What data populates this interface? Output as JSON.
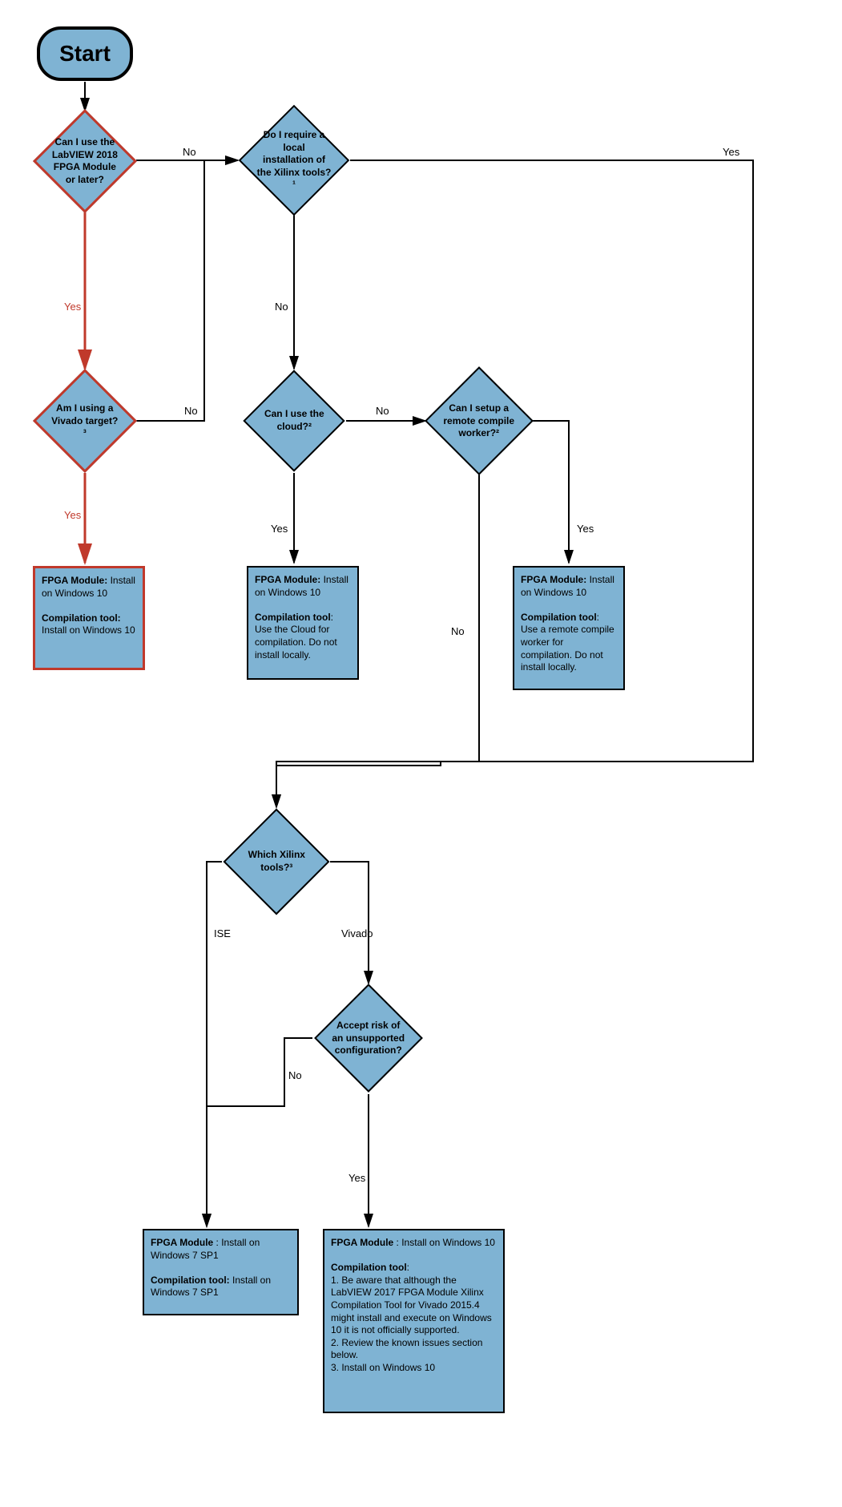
{
  "chart_data": {
    "type": "flowchart",
    "nodes": [
      {
        "id": "start",
        "type": "terminator",
        "text": "Start"
      },
      {
        "id": "q1",
        "type": "decision",
        "text": "Can I use the LabVIEW 2018 FPGA Module or later?"
      },
      {
        "id": "q2",
        "type": "decision",
        "text": "Do I require a local installation of the Xilinx tools?¹"
      },
      {
        "id": "q3",
        "type": "decision",
        "text": "Am I using a Vivado target?³"
      },
      {
        "id": "q4",
        "type": "decision",
        "text": "Can I use the cloud?²"
      },
      {
        "id": "q5",
        "type": "decision",
        "text": "Can I setup a remote compile worker?²"
      },
      {
        "id": "q6",
        "type": "decision",
        "text": "Which Xilinx tools?³"
      },
      {
        "id": "q7",
        "type": "decision",
        "text": "Accept risk of an unsupported configuration?"
      },
      {
        "id": "r1",
        "type": "process",
        "text": "FPGA Module: Install on Windows 10. Compilation tool: Install on Windows 10"
      },
      {
        "id": "r2",
        "type": "process",
        "text": "FPGA Module: Install on Windows 10. Compilation tool: Use the Cloud for compilation. Do not install locally."
      },
      {
        "id": "r3",
        "type": "process",
        "text": "FPGA Module: Install on Windows 10. Compilation tool: Use a remote compile worker for compilation. Do not install locally."
      },
      {
        "id": "r4",
        "type": "process",
        "text": "FPGA Module : Install on Windows 7 SP1. Compilation tool: Install on Windows 7 SP1"
      },
      {
        "id": "r5",
        "type": "process",
        "text": "FPGA Module : Install on Windows 10. Compilation tool: 1. Be aware that although the LabVIEW 2017 FPGA Module Xilinx Compilation Tool for Vivado 2015.4 might install and execute on Windows 10 it is not officially supported. 2. Review the known issues section below. 3. Install on Windows 10"
      }
    ],
    "edges": [
      {
        "from": "start",
        "to": "q1"
      },
      {
        "from": "q1",
        "to": "q3",
        "label": "Yes"
      },
      {
        "from": "q1",
        "to": "q2",
        "label": "No"
      },
      {
        "from": "q3",
        "to": "r1",
        "label": "Yes"
      },
      {
        "from": "q3",
        "to": "q2",
        "label": "No"
      },
      {
        "from": "q2",
        "to": "q4",
        "label": "No"
      },
      {
        "from": "q2",
        "to": "q6",
        "label": "Yes",
        "routing": "via-right"
      },
      {
        "from": "q4",
        "to": "r2",
        "label": "Yes"
      },
      {
        "from": "q4",
        "to": "q5",
        "label": "No"
      },
      {
        "from": "q5",
        "to": "r3",
        "label": "Yes"
      },
      {
        "from": "q5",
        "to": "q6",
        "label": "No"
      },
      {
        "from": "q6",
        "to": "r4",
        "label": "ISE"
      },
      {
        "from": "q6",
        "to": "q7",
        "label": "Vivado"
      },
      {
        "from": "q7",
        "to": "r5",
        "label": "Yes"
      },
      {
        "from": "q7",
        "to": "r4",
        "label": "No"
      }
    ]
  },
  "start": "Start",
  "q1": "Can I use the LabVIEW 2018 FPGA Module or later?",
  "q2": "Do I require a local installation of the Xilinx tools?¹",
  "q3": "Am I using a Vivado target?³",
  "q4": "Can I use the cloud?²",
  "q5": "Can I setup a remote compile worker?²",
  "q6": "Which Xilinx tools?³",
  "q7": "Accept risk of an unsupported configuration?",
  "r1_t1": "FPGA Module:",
  "r1_v1": "Install on Windows 10",
  "r1_t2": "Compilation tool:",
  "r1_v2": "Install on Windows 10",
  "r2_t1": "FPGA Module:",
  "r2_v1": "Install on Windows 10",
  "r2_t2": "Compilation tool",
  "r2_v2": ": Use the Cloud for compilation. Do not install locally.",
  "r3_t1": "FPGA Module:",
  "r3_v1": "Install on Windows 10",
  "r3_t2": "Compilation tool",
  "r3_v2": ": Use a remote compile worker for compilation. Do not install locally.",
  "r4_t1": "FPGA Module",
  "r4_v1": " : Install on Windows 7 SP1",
  "r4_t2": "Compilation tool:",
  "r4_v2": " Install on Windows 7 SP1",
  "r5_t1": "FPGA Module",
  "r5_v1": " : Install on Windows 10",
  "r5_t2": "Compilation tool",
  "r5_l1": "1. Be aware that although the LabVIEW 2017 FPGA Module Xilinx Compilation Tool for Vivado 2015.4 might install and execute on Windows 10 it is not officially supported.",
  "r5_l2": "2. Review the known issues section below.",
  "r5_l3": "3. Install on Windows 10",
  "yes": "Yes",
  "no": "No",
  "ise": "ISE",
  "vivado": "Vivado"
}
